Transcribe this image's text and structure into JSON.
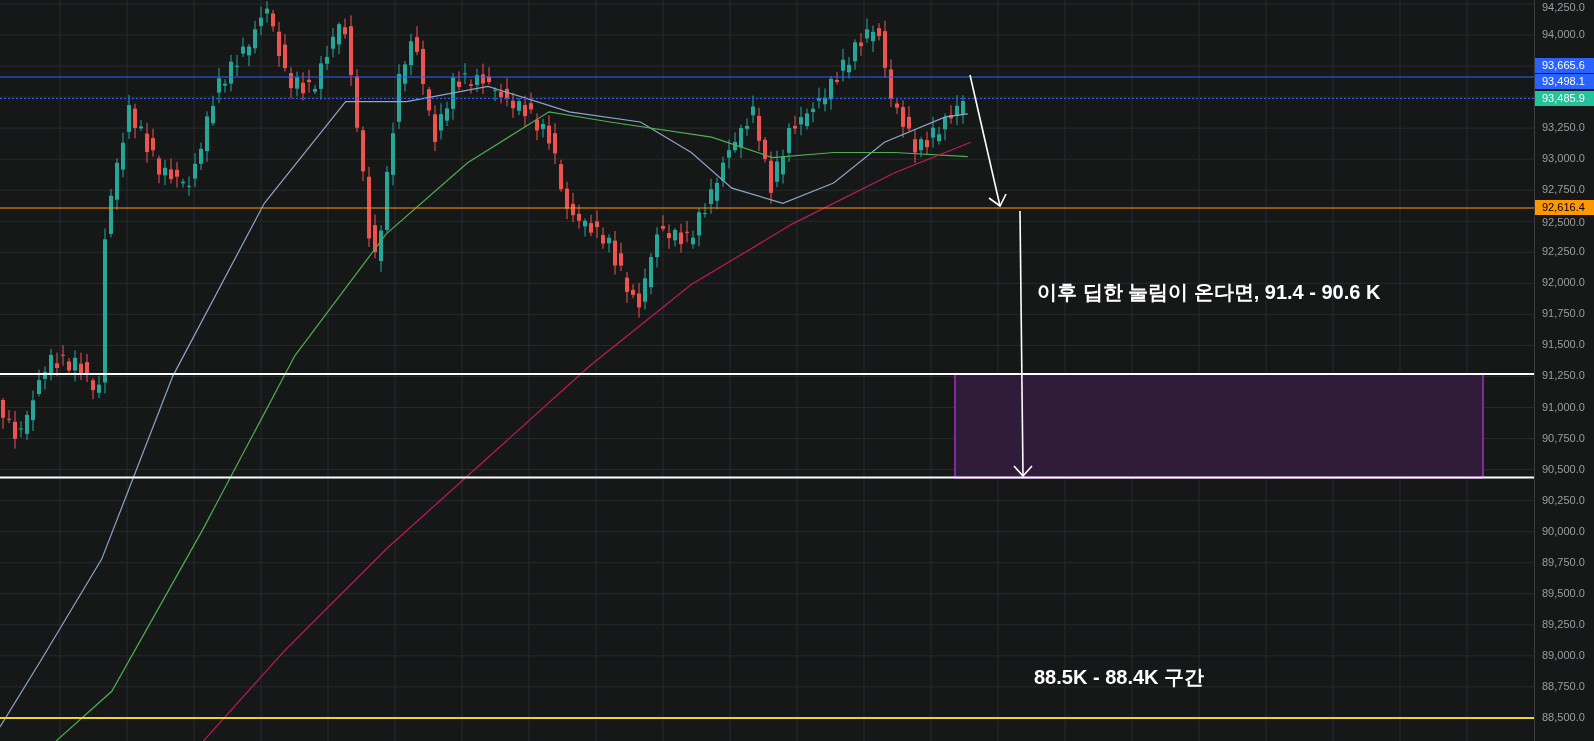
{
  "chart": {
    "annotations": [
      {
        "text": "이후 딥한 눌림이 온다면, 91.4 - 90.6 K"
      },
      {
        "text": "88.5K - 88.4K 구간"
      }
    ]
  },
  "price_axis": {
    "labels": [
      "94,250.0",
      "94,000.0",
      "93,250.0",
      "93,000.0",
      "92,750.0",
      "92,500.0",
      "92,250.0",
      "92,000.0",
      "91,750.0",
      "91,500.0",
      "91,250.0",
      "91,000.0",
      "90,750.0",
      "90,500.0",
      "90,250.0",
      "90,000.0",
      "89,750.0",
      "89,500.0",
      "89,250.0",
      "89,000.0",
      "88,750.0",
      "88,500.0"
    ],
    "price_tags": [
      {
        "text": "93,665.6",
        "color": "#2962ff"
      },
      {
        "text": "93,498.1",
        "color": "#2962ff"
      },
      {
        "text": "93,485.9",
        "color": "#22c39a"
      },
      {
        "text": "92,616.4",
        "color": "#ff9800"
      }
    ]
  }
}
